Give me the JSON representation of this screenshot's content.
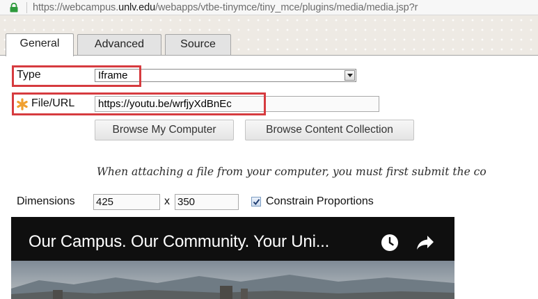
{
  "browser": {
    "url_prefix": "https://webcampus.",
    "url_domain": "unlv.edu",
    "url_path": "/webapps/vtbe-tinymce/tiny_mce/plugins/media/media.jsp?r"
  },
  "tabs": [
    {
      "label": "General",
      "active": true
    },
    {
      "label": "Advanced",
      "active": false
    },
    {
      "label": "Source",
      "active": false
    }
  ],
  "form": {
    "type_label": "Type",
    "type_value": "Iframe",
    "file_url_label": "File/URL",
    "file_url_value": "https://youtu.be/wrfjyXdBnEc",
    "browse_computer_label": "Browse My Computer",
    "browse_collection_label": "Browse Content Collection",
    "note": "When attaching a file from your computer, you must first submit the co",
    "dimensions_label": "Dimensions",
    "width_value": "425",
    "times_symbol": "x",
    "height_value": "350",
    "constrain_label": "Constrain Proportions",
    "constrain_checked": true
  },
  "video": {
    "title": "Our Campus. Our Community. Your Uni...",
    "icons": [
      "clock-icon",
      "share-icon"
    ]
  },
  "colors": {
    "highlight": "#d63b3f",
    "required_star": "#f0a030",
    "lock": "#2e9a3c"
  }
}
